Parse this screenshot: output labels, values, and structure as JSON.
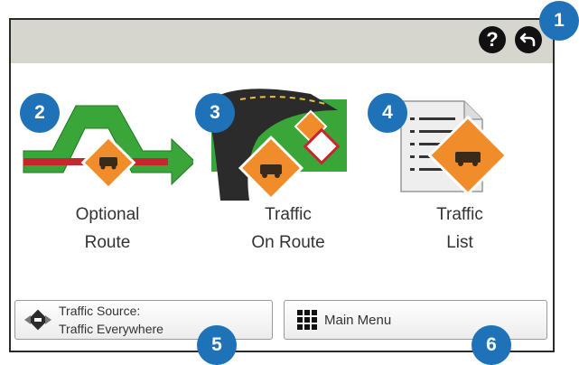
{
  "header": {
    "help_label": "?",
    "help_icon": "question-mark-icon",
    "back_icon": "back-arrow-icon"
  },
  "tiles": [
    {
      "line1": "Optional",
      "line2": "Route",
      "icon": "optional-route-icon"
    },
    {
      "line1": "Traffic",
      "line2": "On Route",
      "icon": "traffic-on-route-icon"
    },
    {
      "line1": "Traffic",
      "line2": "List",
      "icon": "traffic-list-icon"
    }
  ],
  "footer": {
    "source_line1": "Traffic Source:",
    "source_line2": "Traffic Everywhere",
    "source_icon": "traffic-source-icon",
    "menu_label": "Main Menu",
    "menu_icon": "grid-menu-icon"
  },
  "callouts": [
    "1",
    "2",
    "3",
    "4",
    "5",
    "6"
  ],
  "colors": {
    "callout_blue": "#1f72b8",
    "warning_orange": "#f08c2a",
    "route_green": "#3aa63a",
    "topbar_gray": "#d6d6cf"
  }
}
